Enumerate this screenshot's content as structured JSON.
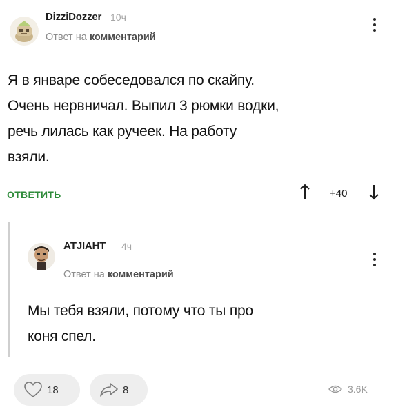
{
  "comment": {
    "author": "DizziDozzer",
    "time": "10ч",
    "reply_prefix": "Ответ на",
    "reply_target": "комментарий",
    "text_lines": [
      "Я в январе собеседовался по скайпу.",
      "Очень нервничал. Выпил 3 рюмки водки,",
      "речь лилась как ручеек. На работу",
      "взяли."
    ],
    "reply_label": "ОТВЕТИТЬ",
    "rating": "+40",
    "avatar_icon": "cartoon-avatar-icon",
    "menu_icon": "kebab-menu-icon"
  },
  "reply": {
    "author": "АТЈІАНТ",
    "time": "4ч",
    "reply_prefix": "Ответ на",
    "reply_target": "комментарий",
    "text_lines": [
      "Мы тебя взяли, потому что ты про",
      "коня спел."
    ],
    "avatar_icon": "portrait-avatar-icon",
    "menu_icon": "kebab-menu-icon"
  },
  "footer": {
    "likes": "18",
    "shares": "8",
    "views": "3.6K",
    "like_icon": "heart-icon",
    "share_icon": "share-icon",
    "views_icon": "eye-icon"
  },
  "colors": {
    "accent": "#2e8b3a",
    "muted": "#8c8c8c",
    "thread_line": "#cfcfcf"
  }
}
